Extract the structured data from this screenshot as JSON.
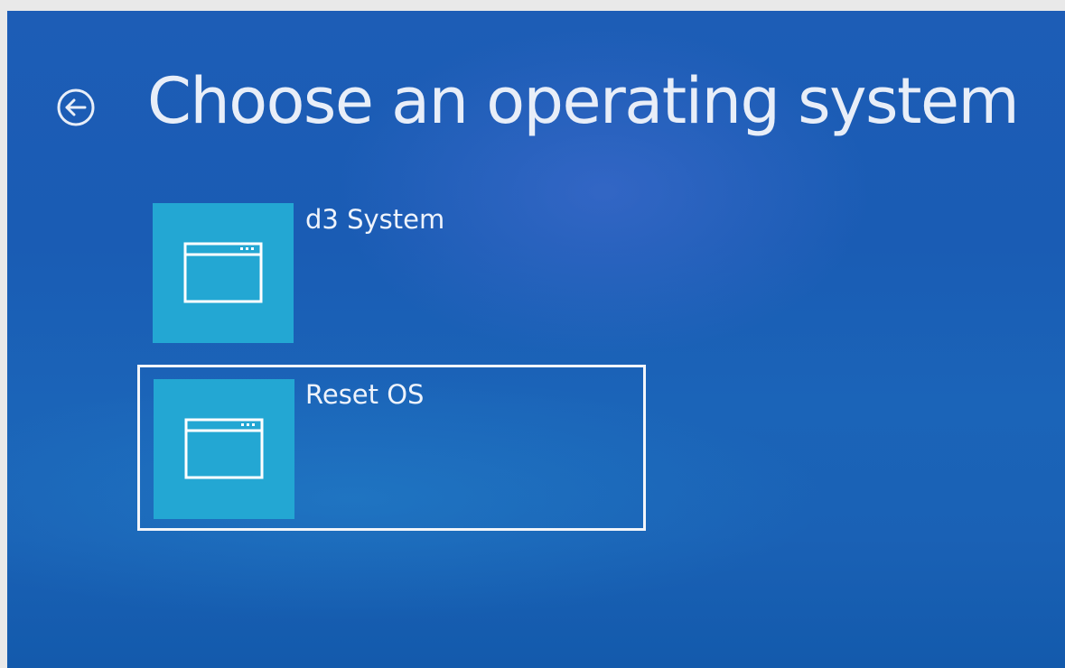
{
  "screen": {
    "title": "Choose an operating system",
    "back_icon": "back-arrow-circle-icon"
  },
  "os_entries": [
    {
      "label": "d3 System",
      "icon": "window-icon",
      "selected": false
    },
    {
      "label": "Reset OS",
      "icon": "window-icon",
      "selected": true
    }
  ],
  "colors": {
    "background": "#1a5cb4",
    "tile": "#23a7d3",
    "text": "#eef3fb",
    "selection_border": "#f2f5fa"
  }
}
